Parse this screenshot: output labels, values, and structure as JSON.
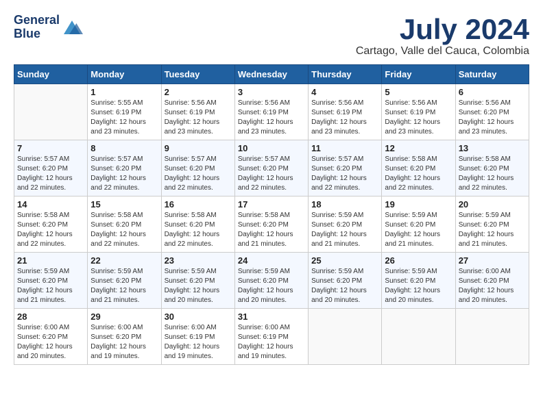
{
  "header": {
    "logo_line1": "General",
    "logo_line2": "Blue",
    "month_title": "July 2024",
    "subtitle": "Cartago, Valle del Cauca, Colombia"
  },
  "days_of_week": [
    "Sunday",
    "Monday",
    "Tuesday",
    "Wednesday",
    "Thursday",
    "Friday",
    "Saturday"
  ],
  "weeks": [
    [
      {
        "day": "",
        "content": ""
      },
      {
        "day": "1",
        "content": "Sunrise: 5:55 AM\nSunset: 6:19 PM\nDaylight: 12 hours\nand 23 minutes."
      },
      {
        "day": "2",
        "content": "Sunrise: 5:56 AM\nSunset: 6:19 PM\nDaylight: 12 hours\nand 23 minutes."
      },
      {
        "day": "3",
        "content": "Sunrise: 5:56 AM\nSunset: 6:19 PM\nDaylight: 12 hours\nand 23 minutes."
      },
      {
        "day": "4",
        "content": "Sunrise: 5:56 AM\nSunset: 6:19 PM\nDaylight: 12 hours\nand 23 minutes."
      },
      {
        "day": "5",
        "content": "Sunrise: 5:56 AM\nSunset: 6:19 PM\nDaylight: 12 hours\nand 23 minutes."
      },
      {
        "day": "6",
        "content": "Sunrise: 5:56 AM\nSunset: 6:20 PM\nDaylight: 12 hours\nand 23 minutes."
      }
    ],
    [
      {
        "day": "7",
        "content": "Sunrise: 5:57 AM\nSunset: 6:20 PM\nDaylight: 12 hours\nand 22 minutes."
      },
      {
        "day": "8",
        "content": "Sunrise: 5:57 AM\nSunset: 6:20 PM\nDaylight: 12 hours\nand 22 minutes."
      },
      {
        "day": "9",
        "content": "Sunrise: 5:57 AM\nSunset: 6:20 PM\nDaylight: 12 hours\nand 22 minutes."
      },
      {
        "day": "10",
        "content": "Sunrise: 5:57 AM\nSunset: 6:20 PM\nDaylight: 12 hours\nand 22 minutes."
      },
      {
        "day": "11",
        "content": "Sunrise: 5:57 AM\nSunset: 6:20 PM\nDaylight: 12 hours\nand 22 minutes."
      },
      {
        "day": "12",
        "content": "Sunrise: 5:58 AM\nSunset: 6:20 PM\nDaylight: 12 hours\nand 22 minutes."
      },
      {
        "day": "13",
        "content": "Sunrise: 5:58 AM\nSunset: 6:20 PM\nDaylight: 12 hours\nand 22 minutes."
      }
    ],
    [
      {
        "day": "14",
        "content": "Sunrise: 5:58 AM\nSunset: 6:20 PM\nDaylight: 12 hours\nand 22 minutes."
      },
      {
        "day": "15",
        "content": "Sunrise: 5:58 AM\nSunset: 6:20 PM\nDaylight: 12 hours\nand 22 minutes."
      },
      {
        "day": "16",
        "content": "Sunrise: 5:58 AM\nSunset: 6:20 PM\nDaylight: 12 hours\nand 22 minutes."
      },
      {
        "day": "17",
        "content": "Sunrise: 5:58 AM\nSunset: 6:20 PM\nDaylight: 12 hours\nand 21 minutes."
      },
      {
        "day": "18",
        "content": "Sunrise: 5:59 AM\nSunset: 6:20 PM\nDaylight: 12 hours\nand 21 minutes."
      },
      {
        "day": "19",
        "content": "Sunrise: 5:59 AM\nSunset: 6:20 PM\nDaylight: 12 hours\nand 21 minutes."
      },
      {
        "day": "20",
        "content": "Sunrise: 5:59 AM\nSunset: 6:20 PM\nDaylight: 12 hours\nand 21 minutes."
      }
    ],
    [
      {
        "day": "21",
        "content": "Sunrise: 5:59 AM\nSunset: 6:20 PM\nDaylight: 12 hours\nand 21 minutes."
      },
      {
        "day": "22",
        "content": "Sunrise: 5:59 AM\nSunset: 6:20 PM\nDaylight: 12 hours\nand 21 minutes."
      },
      {
        "day": "23",
        "content": "Sunrise: 5:59 AM\nSunset: 6:20 PM\nDaylight: 12 hours\nand 20 minutes."
      },
      {
        "day": "24",
        "content": "Sunrise: 5:59 AM\nSunset: 6:20 PM\nDaylight: 12 hours\nand 20 minutes."
      },
      {
        "day": "25",
        "content": "Sunrise: 5:59 AM\nSunset: 6:20 PM\nDaylight: 12 hours\nand 20 minutes."
      },
      {
        "day": "26",
        "content": "Sunrise: 5:59 AM\nSunset: 6:20 PM\nDaylight: 12 hours\nand 20 minutes."
      },
      {
        "day": "27",
        "content": "Sunrise: 6:00 AM\nSunset: 6:20 PM\nDaylight: 12 hours\nand 20 minutes."
      }
    ],
    [
      {
        "day": "28",
        "content": "Sunrise: 6:00 AM\nSunset: 6:20 PM\nDaylight: 12 hours\nand 20 minutes."
      },
      {
        "day": "29",
        "content": "Sunrise: 6:00 AM\nSunset: 6:20 PM\nDaylight: 12 hours\nand 19 minutes."
      },
      {
        "day": "30",
        "content": "Sunrise: 6:00 AM\nSunset: 6:19 PM\nDaylight: 12 hours\nand 19 minutes."
      },
      {
        "day": "31",
        "content": "Sunrise: 6:00 AM\nSunset: 6:19 PM\nDaylight: 12 hours\nand 19 minutes."
      },
      {
        "day": "",
        "content": ""
      },
      {
        "day": "",
        "content": ""
      },
      {
        "day": "",
        "content": ""
      }
    ]
  ]
}
